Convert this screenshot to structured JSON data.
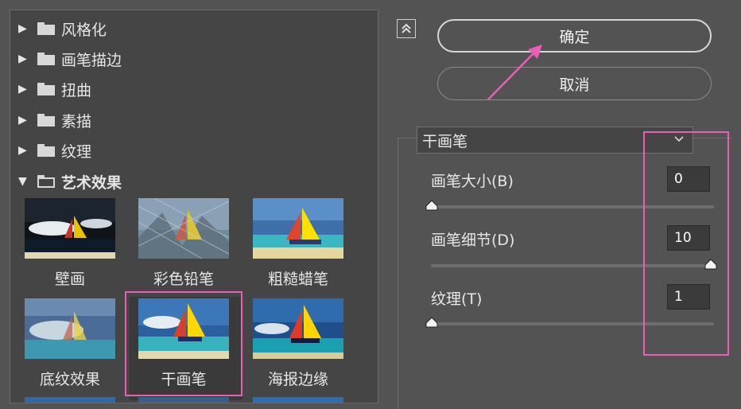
{
  "categories": [
    {
      "label": "风格化",
      "expanded": false
    },
    {
      "label": "画笔描边",
      "expanded": false
    },
    {
      "label": "扭曲",
      "expanded": false
    },
    {
      "label": "素描",
      "expanded": false
    },
    {
      "label": "纹理",
      "expanded": false
    },
    {
      "label": "艺术效果",
      "expanded": true
    }
  ],
  "thumbnails": [
    {
      "label": "壁画"
    },
    {
      "label": "彩色铅笔"
    },
    {
      "label": "粗糙蜡笔"
    },
    {
      "label": "底纹效果"
    },
    {
      "label": "干画笔",
      "selected": true
    },
    {
      "label": "海报边缘"
    }
  ],
  "buttons": {
    "ok": "确定",
    "cancel": "取消"
  },
  "filter": {
    "selected": "干画笔"
  },
  "params": [
    {
      "label": "画笔大小(B)",
      "value": "0",
      "slider": 0.0
    },
    {
      "label": "画笔细节(D)",
      "value": "10",
      "slider": 1.0
    },
    {
      "label": "纹理(T)",
      "value": "1",
      "slider": 0.0
    }
  ],
  "colors": {
    "panel": "#535353",
    "list_bg": "#454545",
    "highlight": "#e95fb1"
  }
}
